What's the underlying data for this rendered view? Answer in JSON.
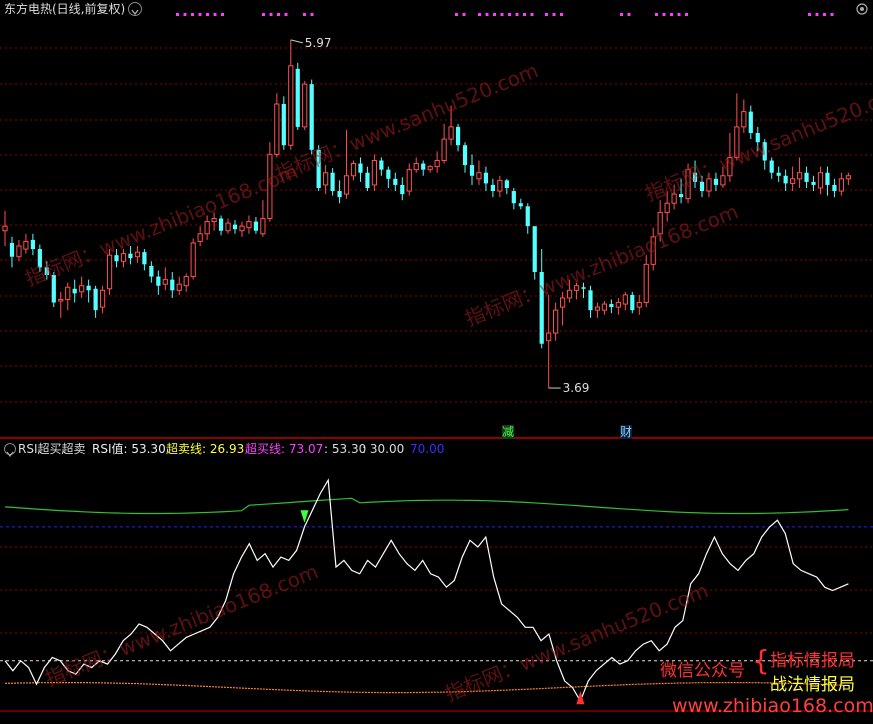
{
  "window": {
    "title": "东方电热(日线,前复权)",
    "colors": {
      "bg": "#000000",
      "up": "#ff5050",
      "down": "#54ffff",
      "grid": "#8a0000",
      "axis": "#b00000",
      "marker": "#ff3cff"
    }
  },
  "main_chart": {
    "high_label": "5.97",
    "low_label": "3.69",
    "event_tags": [
      "减",
      "财"
    ]
  },
  "indicator": {
    "name": "RSI超买超卖",
    "rsi_label": "RSI值: 53.30",
    "oversold_label": "超卖线: 26.93",
    "overbought_label": "超买线: 73.07",
    "v1": ": 53.30",
    "v2": ": 30.00",
    "v3": "70.00",
    "colors": {
      "rsi": "#ffffff",
      "oversold_text": "#ffff40",
      "overbought_text": "#ff40ff",
      "v3": "#3030ff"
    }
  },
  "watermarks": [
    "指标网：www.zhibiao168.com",
    "指标网：www.sanhu520.com",
    "指标网：www.zhibiao168.com",
    "指标网：www.sanhu520.com",
    "指标网：www.zhibiao168.com",
    "指标网：www.sanhu520.com"
  ],
  "promo": {
    "line1": "微信公众号",
    "line2": "指标情报局",
    "line3": "战法情报局",
    "footer": "www.zhibiao168.com"
  },
  "chart_data": {
    "type": "candlestick",
    "candles": [
      [
        4.72,
        4.75,
        4.62,
        4.85
      ],
      [
        4.64,
        4.55,
        4.48,
        4.68
      ],
      [
        4.55,
        4.62,
        4.52,
        4.66
      ],
      [
        4.6,
        4.65,
        4.57,
        4.7
      ],
      [
        4.66,
        4.6,
        4.56,
        4.7
      ],
      [
        4.6,
        4.48,
        4.45,
        4.63
      ],
      [
        4.48,
        4.43,
        4.4,
        4.52
      ],
      [
        4.43,
        4.25,
        4.22,
        4.45
      ],
      [
        4.26,
        4.27,
        4.15,
        4.32
      ],
      [
        4.27,
        4.35,
        4.2,
        4.38
      ],
      [
        4.34,
        4.31,
        4.25,
        4.4
      ],
      [
        4.32,
        4.36,
        4.28,
        4.42
      ],
      [
        4.36,
        4.33,
        4.25,
        4.4
      ],
      [
        4.34,
        4.2,
        4.15,
        4.36
      ],
      [
        4.22,
        4.33,
        4.18,
        4.36
      ],
      [
        4.34,
        4.56,
        4.3,
        4.6
      ],
      [
        4.56,
        4.52,
        4.48,
        4.6
      ],
      [
        4.52,
        4.57,
        4.48,
        4.6
      ],
      [
        4.57,
        4.54,
        4.5,
        4.62
      ],
      [
        4.55,
        4.58,
        4.51,
        4.62
      ],
      [
        4.58,
        4.5,
        4.46,
        4.6
      ],
      [
        4.49,
        4.42,
        4.38,
        4.52
      ],
      [
        4.42,
        4.36,
        4.3,
        4.46
      ],
      [
        4.37,
        4.4,
        4.33,
        4.48
      ],
      [
        4.4,
        4.33,
        4.28,
        4.45
      ],
      [
        4.33,
        4.37,
        4.3,
        4.42
      ],
      [
        4.36,
        4.42,
        4.32,
        4.44
      ],
      [
        4.42,
        4.64,
        4.4,
        4.67
      ],
      [
        4.65,
        4.7,
        4.62,
        4.75
      ],
      [
        4.7,
        4.78,
        4.66,
        4.82
      ],
      [
        4.78,
        4.8,
        4.72,
        4.84
      ],
      [
        4.8,
        4.72,
        4.69,
        4.82
      ],
      [
        4.72,
        4.77,
        4.7,
        4.8
      ],
      [
        4.76,
        4.73,
        4.7,
        4.79
      ],
      [
        4.72,
        4.75,
        4.68,
        4.78
      ],
      [
        4.74,
        4.78,
        4.7,
        4.82
      ],
      [
        4.78,
        4.72,
        4.7,
        4.81
      ],
      [
        4.7,
        4.8,
        4.68,
        4.92
      ],
      [
        4.8,
        5.22,
        4.78,
        5.3
      ],
      [
        5.22,
        5.55,
        5.2,
        5.62
      ],
      [
        5.55,
        5.28,
        5.25,
        5.6
      ],
      [
        5.28,
        5.8,
        5.25,
        5.97
      ],
      [
        5.78,
        5.4,
        5.38,
        5.82
      ],
      [
        5.4,
        5.68,
        5.38,
        5.7
      ],
      [
        5.68,
        5.25,
        5.22,
        5.71
      ],
      [
        5.25,
        5.0,
        4.98,
        5.28
      ],
      [
        5.02,
        5.1,
        4.96,
        5.15
      ],
      [
        5.1,
        4.98,
        4.95,
        5.13
      ],
      [
        4.98,
        4.94,
        4.9,
        5.05
      ],
      [
        4.96,
        5.08,
        4.93,
        5.38
      ],
      [
        5.08,
        5.16,
        5.05,
        5.18
      ],
      [
        5.16,
        5.1,
        5.04,
        5.2
      ],
      [
        5.1,
        5.0,
        4.98,
        5.14
      ],
      [
        5.02,
        5.18,
        4.98,
        5.22
      ],
      [
        5.18,
        5.12,
        5.08,
        5.2
      ],
      [
        5.12,
        5.06,
        5.0,
        5.14
      ],
      [
        5.06,
        5.02,
        4.98,
        5.1
      ],
      [
        5.02,
        4.96,
        4.92,
        5.07
      ],
      [
        4.98,
        5.12,
        4.95,
        5.16
      ],
      [
        5.12,
        5.16,
        5.1,
        5.2
      ],
      [
        5.16,
        5.12,
        5.08,
        5.18
      ],
      [
        5.12,
        5.14,
        5.1,
        5.15
      ],
      [
        5.14,
        5.18,
        5.1,
        5.24
      ],
      [
        5.18,
        5.32,
        5.16,
        5.42
      ],
      [
        5.32,
        5.4,
        5.28,
        5.54
      ],
      [
        5.4,
        5.28,
        5.24,
        5.42
      ],
      [
        5.28,
        5.15,
        5.1,
        5.3
      ],
      [
        5.15,
        5.08,
        5.02,
        5.22
      ],
      [
        5.06,
        5.1,
        5.02,
        5.18
      ],
      [
        5.1,
        5.03,
        4.98,
        5.14
      ],
      [
        5.02,
        4.98,
        4.94,
        5.06
      ],
      [
        4.98,
        5.05,
        4.94,
        5.08
      ],
      [
        5.05,
        5.0,
        4.96,
        5.06
      ],
      [
        4.98,
        4.9,
        4.86,
        5.0
      ],
      [
        4.9,
        4.88,
        4.86,
        4.93
      ],
      [
        4.88,
        4.75,
        4.7,
        4.9
      ],
      [
        4.75,
        4.45,
        4.4,
        4.6
      ],
      [
        4.45,
        3.98,
        3.95,
        4.6
      ],
      [
        4.0,
        4.05,
        3.69,
        4.3
      ],
      [
        4.05,
        4.2,
        4.0,
        4.25
      ],
      [
        4.22,
        4.28,
        4.1,
        4.32
      ],
      [
        4.28,
        4.33,
        4.25,
        4.4
      ],
      [
        4.33,
        4.36,
        4.27,
        4.38
      ],
      [
        4.35,
        4.34,
        4.28,
        4.38
      ],
      [
        4.33,
        4.2,
        4.15,
        4.36
      ],
      [
        4.2,
        4.22,
        4.15,
        4.25
      ],
      [
        4.2,
        4.24,
        4.17,
        4.26
      ],
      [
        4.24,
        4.22,
        4.18,
        4.27
      ],
      [
        4.22,
        4.25,
        4.17,
        4.28
      ],
      [
        4.24,
        4.3,
        4.2,
        4.32
      ],
      [
        4.3,
        4.2,
        4.18,
        4.32
      ],
      [
        4.22,
        4.25,
        4.17,
        4.3
      ],
      [
        4.25,
        4.5,
        4.22,
        4.56
      ],
      [
        4.5,
        4.68,
        4.46,
        4.74
      ],
      [
        4.7,
        4.84,
        4.65,
        4.92
      ],
      [
        4.84,
        4.9,
        4.78,
        4.98
      ],
      [
        4.9,
        4.96,
        4.86,
        5.02
      ],
      [
        4.96,
        4.94,
        4.9,
        5.06
      ],
      [
        4.93,
        5.12,
        4.9,
        5.16
      ],
      [
        5.1,
        5.04,
        5.0,
        5.18
      ],
      [
        5.04,
        4.98,
        4.94,
        5.08
      ],
      [
        4.98,
        5.06,
        4.94,
        5.1
      ],
      [
        5.06,
        5.02,
        4.98,
        5.1
      ],
      [
        5.02,
        5.08,
        5.0,
        5.14
      ],
      [
        5.08,
        5.2,
        5.04,
        5.36
      ],
      [
        5.2,
        5.4,
        5.18,
        5.62
      ],
      [
        5.4,
        5.5,
        5.36,
        5.58
      ],
      [
        5.5,
        5.36,
        5.32,
        5.54
      ],
      [
        5.36,
        5.3,
        5.24,
        5.4
      ],
      [
        5.3,
        5.18,
        5.12,
        5.32
      ],
      [
        5.18,
        5.1,
        5.06,
        5.2
      ],
      [
        5.1,
        5.08,
        5.04,
        5.14
      ],
      [
        5.08,
        5.03,
        4.98,
        5.12
      ],
      [
        5.03,
        5.06,
        4.98,
        5.14
      ],
      [
        5.06,
        5.1,
        5.0,
        5.2
      ],
      [
        5.1,
        5.04,
        5.0,
        5.14
      ],
      [
        5.04,
        5.02,
        4.98,
        5.08
      ],
      [
        5.0,
        5.1,
        4.96,
        5.14
      ],
      [
        5.1,
        5.02,
        4.95,
        5.14
      ],
      [
        5.02,
        4.98,
        4.94,
        5.06
      ],
      [
        4.98,
        5.06,
        4.95,
        5.1
      ],
      [
        5.06,
        5.08,
        5.02,
        5.1
      ]
    ],
    "rsi": [
      30,
      27,
      30,
      28,
      23,
      28,
      31,
      30,
      27,
      26,
      29,
      28,
      30,
      29,
      32,
      36,
      38,
      41,
      40,
      38,
      36,
      33,
      35,
      37,
      38,
      39,
      40,
      43,
      48,
      56,
      61,
      65,
      60,
      62,
      58,
      61,
      60,
      63,
      70,
      75,
      80,
      84,
      58,
      60,
      57,
      56,
      60,
      58,
      62,
      66,
      62,
      59,
      57,
      60,
      56,
      55,
      52,
      54,
      61,
      66,
      64,
      67,
      55,
      47,
      45,
      43,
      40,
      40,
      36,
      38,
      30,
      24,
      22,
      18,
      24,
      27,
      29,
      31,
      29,
      30,
      33,
      35,
      36,
      33,
      35,
      40,
      42,
      53,
      56,
      62,
      67,
      62,
      59,
      57,
      60,
      62,
      67,
      70,
      72,
      68,
      59,
      57,
      56,
      55,
      52,
      51,
      52,
      53
    ]
  }
}
